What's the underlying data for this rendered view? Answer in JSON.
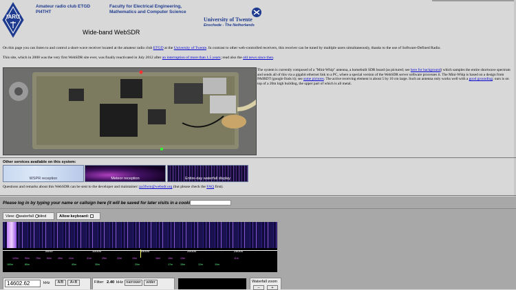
{
  "header": {
    "club_line1": "Amateur radio club ETGD",
    "club_line2": "PI4THT",
    "faculty_line1": "Faculty for Electrical Engineering,",
    "faculty_line2": "Mathematics and Computer Science",
    "university_name": "University of Twente",
    "university_tag": "Enschede - The Netherlands",
    "title": "Wide-band WebSDR"
  },
  "intro": {
    "p1_a": "On this page you can listen to and control a short-wave receiver located at the amateur radio club ",
    "p1_link1": "ETGD",
    "p1_b": " at the ",
    "p1_link2": "University of Twente",
    "p1_c": ". In contrast to other web-controlled receivers, this receiver can be tuned by multiple users simultaneously, thanks to the use of Software-Defined Radio.",
    "p2_a": "This site, which in 2008 was the very first WebSDR site ever, was finally reactivated in July 2012 after ",
    "p2_link1": "an interruption of more than 1.5 years",
    "p2_b": "; read also the ",
    "p2_link2": "old news since then",
    "p2_c": "."
  },
  "photo_desc": {
    "a": "The system is currently composed of a \"Mini-Whip\" antenna, a homebuilt SDR board (as pictured; see ",
    "link1": "here for background",
    "b": ") which samples the entire shortwave spectrum and sends all of this via a gigabit ethernet link to a PC, where a special version of the WebSDR server software processes it. The Mini-Whip is based on a design from PA0RDT (google finds it); see ",
    "link2": "some pictures",
    "c": ". The active receiving element is about 5 by 10 cm large. Such an antenna only works well with a ",
    "link3": "good grounding",
    "d": "; ours is on top of a 20m high building, the upper part of which is all metal."
  },
  "services": {
    "heading": "Other services available on this system:",
    "items": [
      {
        "label": "WSPR reception"
      },
      {
        "label": "Meteor reception"
      },
      {
        "label": "Entire-day waterfall display"
      }
    ]
  },
  "contact": {
    "a": "Questions and remarks about this WebSDR can be sent to the developer and maintainer: ",
    "link1": "pa3fwm@websdr.org",
    "b": " (but please check the ",
    "link2": "FAQ",
    "c": " first)."
  },
  "login": {
    "prompt": "Please log in by typing your name or callsign here (it will be saved for later visits in a cookie):"
  },
  "view": {
    "label": "View:",
    "opt_waterfall": "waterfall",
    "opt_blind": "blind",
    "keyboard_label": "Allow keyboard:"
  },
  "waterfall": {
    "scale_labels": [
      "5000",
      "10000",
      "15000",
      "20000",
      "25000"
    ],
    "band_labels": [
      "120m",
      "90m",
      "75m",
      "60m",
      "49m",
      "41m",
      "31m",
      "25m",
      "22m",
      "19m",
      "16m",
      "15m",
      "13m",
      "11m",
      "160m",
      "80m",
      "40m",
      "30m",
      "20m",
      "17m",
      "15m",
      "12m",
      "10m"
    ]
  },
  "tuning": {
    "frequency": "14602.62",
    "unit": "kHz",
    "btn_ab": "A/B",
    "btn_aplusb": "A+B",
    "filter_label": "Filter:",
    "filter_value": "2.40",
    "filter_unit": "kHz",
    "btn_narrower": "narrower",
    "btn_wider": "wider",
    "wf_zoom_label": "Waterfall zoom",
    "zoom_minus": "–",
    "zoom_plus": "+"
  }
}
